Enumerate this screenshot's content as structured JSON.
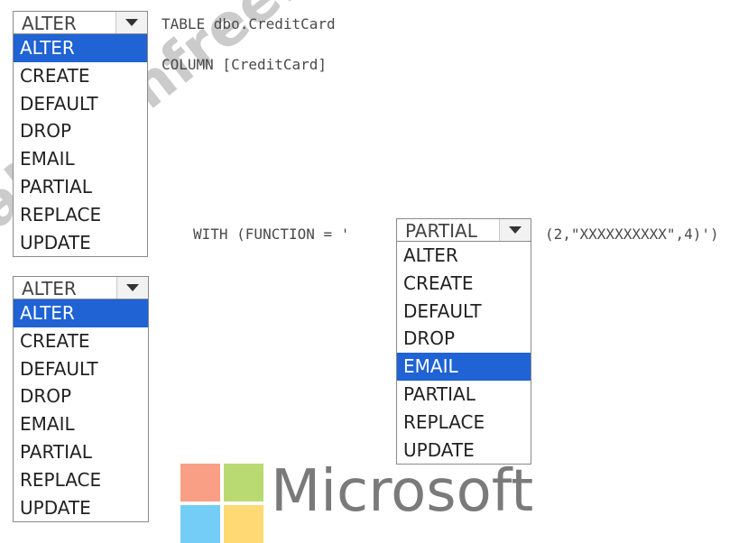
{
  "code": {
    "line1_suffix": "TABLE dbo.CreditCard",
    "line2": "COLUMN [CreditCard]",
    "with_prefix": "WITH (FUNCTION = '",
    "with_suffix": "(2,\"XXXXXXXXXX\",4)')"
  },
  "dropdowns": [
    {
      "id": "dropdown-1",
      "selected_display": "ALTER",
      "highlighted": "ALTER",
      "options": [
        "ALTER",
        "CREATE",
        "DEFAULT",
        "DROP",
        "EMAIL",
        "PARTIAL",
        "REPLACE",
        "UPDATE"
      ]
    },
    {
      "id": "dropdown-2",
      "selected_display": "ALTER",
      "highlighted": "ALTER",
      "options": [
        "ALTER",
        "CREATE",
        "DEFAULT",
        "DROP",
        "EMAIL",
        "PARTIAL",
        "REPLACE",
        "UPDATE"
      ]
    },
    {
      "id": "dropdown-3",
      "selected_display": "PARTIAL",
      "highlighted": "EMAIL",
      "options": [
        "ALTER",
        "CREATE",
        "DEFAULT",
        "DROP",
        "EMAIL",
        "PARTIAL",
        "REPLACE",
        "UPDATE"
      ]
    }
  ],
  "watermark": "alexamfree.com",
  "brand": {
    "name": "Microsoft",
    "logo_colors": [
      "#f25022",
      "#7fba00",
      "#00a4ef",
      "#ffb900"
    ],
    "highlight_color": "#1f63d4"
  }
}
